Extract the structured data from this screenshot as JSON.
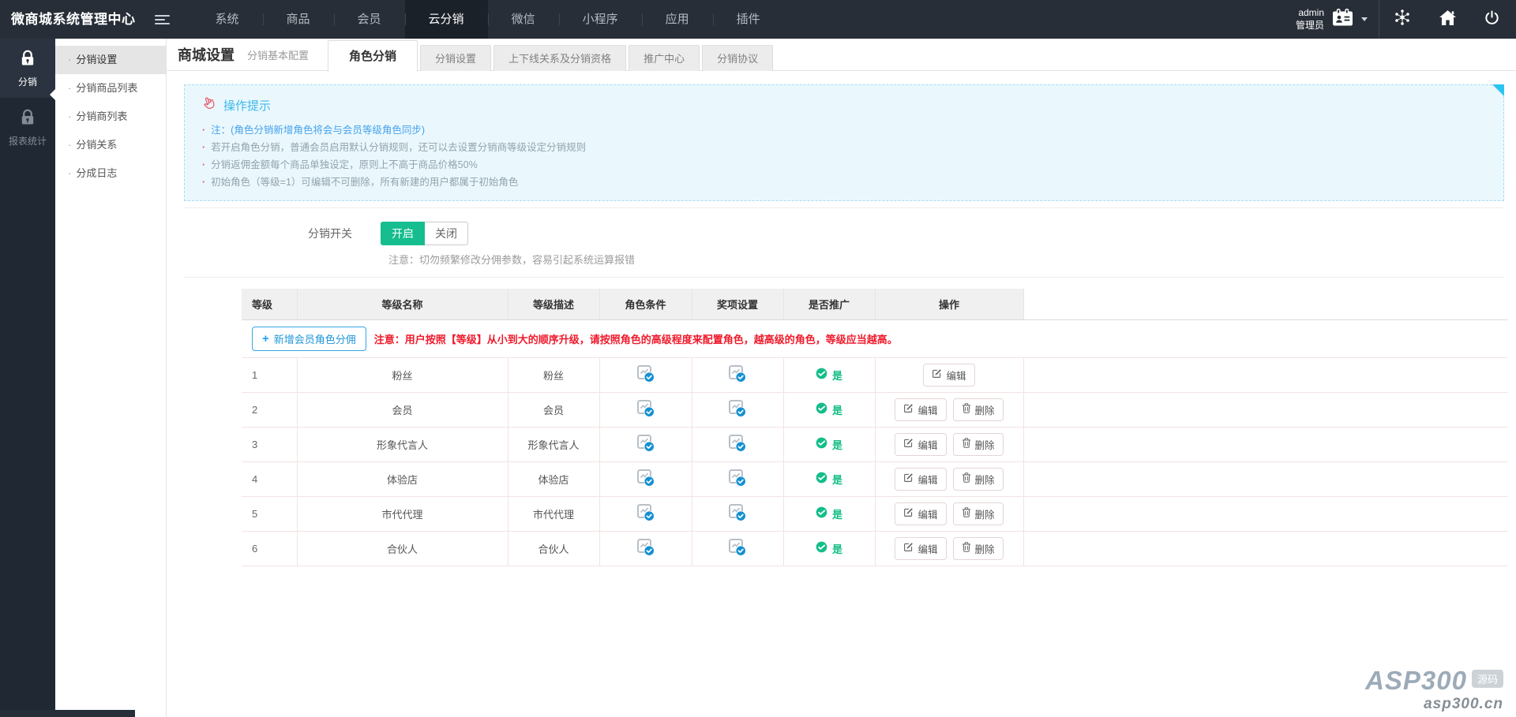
{
  "navbar": {
    "logo": "微商城系统管理中心",
    "menu": [
      {
        "id": "system",
        "label": "系统",
        "active": false
      },
      {
        "id": "goods",
        "label": "商品",
        "active": false
      },
      {
        "id": "member",
        "label": "会员",
        "active": false
      },
      {
        "id": "cloud-distribution",
        "label": "云分销",
        "active": true
      },
      {
        "id": "wechat",
        "label": "微信",
        "active": false
      },
      {
        "id": "miniprogram",
        "label": "小程序",
        "active": false
      },
      {
        "id": "application",
        "label": "应用",
        "active": false
      },
      {
        "id": "plugin",
        "label": "插件",
        "active": false
      }
    ],
    "user": {
      "name": "admin",
      "role": "管理员"
    }
  },
  "rail": {
    "items": [
      {
        "id": "distribution",
        "label": "分销",
        "active": true
      },
      {
        "id": "report-stats",
        "label": "报表统计",
        "active": false
      }
    ]
  },
  "submenu": {
    "items": [
      {
        "id": "dist-settings",
        "label": "分销设置",
        "active": true
      },
      {
        "id": "dist-goods-list",
        "label": "分销商品列表",
        "active": false
      },
      {
        "id": "distributor-list",
        "label": "分销商列表",
        "active": false
      },
      {
        "id": "dist-relations",
        "label": "分销关系",
        "active": false
      },
      {
        "id": "commission-log",
        "label": "分成日志",
        "active": false
      }
    ]
  },
  "page": {
    "title": "商城设置",
    "subtitle": "分销基本配置"
  },
  "tabs": [
    {
      "id": "role-distribution",
      "label": "角色分销",
      "active": true
    },
    {
      "id": "distribution-settings",
      "label": "分销设置",
      "active": false
    },
    {
      "id": "updown-relation",
      "label": "上下线关系及分销资格",
      "active": false
    },
    {
      "id": "promotion-center",
      "label": "推广中心",
      "active": false
    },
    {
      "id": "distribution-agreement",
      "label": "分销协议",
      "active": false
    }
  ],
  "tips": {
    "title": "操作提示",
    "items": [
      {
        "text": "注：(角色分销新增角色将会与会员等级角色同步)",
        "highlight": true
      },
      {
        "text": "若开启角色分销，普通会员启用默认分销规则，还可以去设置分销商等级设定分销规则",
        "highlight": false
      },
      {
        "text": "分销返佣金额每个商品单独设定，原则上不高于商品价格50%",
        "highlight": false
      },
      {
        "text": "初始角色（等级=1）可编辑不可删除，所有新建的用户都属于初始角色",
        "highlight": false
      }
    ]
  },
  "switch": {
    "label": "分销开关",
    "on": "开启",
    "off": "关闭",
    "state": "开启",
    "note": "注意：切勿频繁修改分佣参数，容易引起系统运算报错"
  },
  "table": {
    "headers": [
      "等级",
      "等级名称",
      "等级描述",
      "角色条件",
      "奖项设置",
      "是否推广",
      "操作"
    ],
    "add_button_label": "新增会员角色分佣",
    "notice": "注意：用户按照【等级】从小到大的顺序升级，请按照角色的高级程度来配置角色，越高级的角色，等级应当越高。",
    "action_labels": {
      "edit": "编辑",
      "delete": "删除"
    },
    "promote_yes": "是",
    "rows": [
      {
        "level": "1",
        "name": "粉丝",
        "desc": "粉丝",
        "promote": "是",
        "actions": [
          "edit"
        ]
      },
      {
        "level": "2",
        "name": "会员",
        "desc": "会员",
        "promote": "是",
        "actions": [
          "edit",
          "delete"
        ]
      },
      {
        "level": "3",
        "name": "形象代言人",
        "desc": "形象代言人",
        "promote": "是",
        "actions": [
          "edit",
          "delete"
        ]
      },
      {
        "level": "4",
        "name": "体验店",
        "desc": "体验店",
        "promote": "是",
        "actions": [
          "edit",
          "delete"
        ]
      },
      {
        "level": "5",
        "name": "市代代理",
        "desc": "市代代理",
        "promote": "是",
        "actions": [
          "edit",
          "delete"
        ]
      },
      {
        "level": "6",
        "name": "合伙人",
        "desc": "合伙人",
        "promote": "是",
        "actions": [
          "edit",
          "delete"
        ]
      }
    ]
  },
  "watermark": {
    "brand": "ASP300",
    "badge": "源码",
    "domain": "asp300.cn"
  },
  "icons": {
    "hamburger": "menu-bars",
    "user_card": "id-card",
    "caret": "chevron-down",
    "share": "share-nodes",
    "home": "home",
    "power": "power-off",
    "rail_item": "padlock",
    "tip_title": "pointing-hand",
    "condition_cell": "doc-check",
    "promote_cell": "check-circle",
    "edit": "pencil-square",
    "delete": "trash"
  },
  "colors": {
    "navbar_bg": "#272e37",
    "rail_bg": "#202834",
    "primary_green": "#16bd8e",
    "tip_blue": "#3db8e8",
    "link_blue": "#2197da",
    "badge_blue": "#1590d2",
    "danger_red": "#f01a2b",
    "table_border": "#f3e2e2"
  }
}
